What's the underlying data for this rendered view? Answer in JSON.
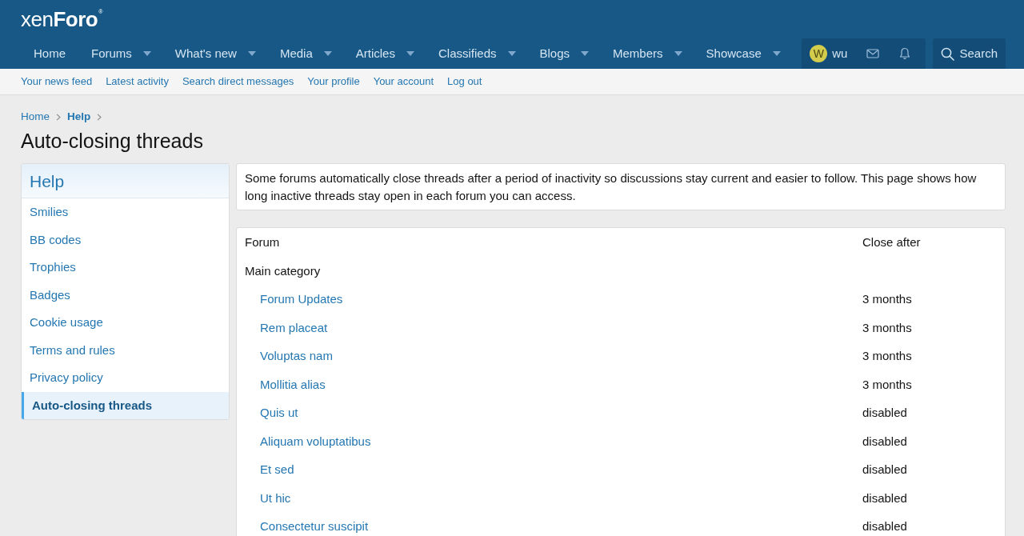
{
  "header": {
    "logo": "xen**Foro**$^{®}$"
  },
  "nav": {
    "tabs": [
      {
        "label": "Home",
        "has_menu": false
      },
      {
        "label": "Forums",
        "has_menu": true
      },
      {
        "label": "What's new",
        "has_menu": true
      },
      {
        "label": "Media",
        "has_menu": true
      },
      {
        "label": "Articles",
        "has_menu": true
      },
      {
        "label": "Classifieds",
        "has_menu": true
      },
      {
        "label": "Blogs",
        "has_menu": true
      },
      {
        "label": "Members",
        "has_menu": true
      },
      {
        "label": "Showcase",
        "has_menu": true
      }
    ],
    "user": {
      "avatar_letter": "W",
      "name": "wu"
    },
    "search": {
      "label": "Search"
    }
  },
  "sub_nav": [
    "Your news feed",
    "Latest activity",
    "Search direct messages",
    "Your profile",
    "Your account",
    "Log out"
  ],
  "breadcrumbs": [
    {
      "label": "Home",
      "current": false
    },
    {
      "label": "Help",
      "current": true
    }
  ],
  "page_title": "Auto-closing threads",
  "sidebar": {
    "title": "Help",
    "items": [
      {
        "label": "Smilies",
        "selected": false
      },
      {
        "label": "BB codes",
        "selected": false
      },
      {
        "label": "Trophies",
        "selected": false
      },
      {
        "label": "Badges",
        "selected": false
      },
      {
        "label": "Cookie usage",
        "selected": false
      },
      {
        "label": "Terms and rules",
        "selected": false
      },
      {
        "label": "Privacy policy",
        "selected": false
      },
      {
        "label": "Auto-closing threads",
        "selected": true
      }
    ]
  },
  "description": "Some forums automatically close threads after a period of inactivity so discussions stay current and easier to follow. This page shows how long inactive threads stay open in each forum you can access.",
  "table": {
    "columns": [
      "Forum",
      "Close after"
    ],
    "rows": [
      {
        "forum": "Main category",
        "children": [
          {
            "forum": "Forum Updates",
            "close_after": "3 months"
          },
          {
            "forum": "Rem placeat",
            "close_after": "3 months"
          },
          {
            "forum": "Voluptas nam",
            "close_after": "3 months"
          },
          {
            "forum": "Mollitia alias",
            "close_after": "3 months"
          },
          {
            "forum": "Quis ut",
            "close_after": "disabled"
          },
          {
            "forum": "Aliquam voluptatibus",
            "close_after": "disabled"
          },
          {
            "forum": "Et sed",
            "close_after": "disabled"
          },
          {
            "forum": "Ut hic",
            "close_after": "disabled"
          },
          {
            "forum": "Consectetur suscipit",
            "close_after": "disabled"
          }
        ]
      }
    ]
  }
}
